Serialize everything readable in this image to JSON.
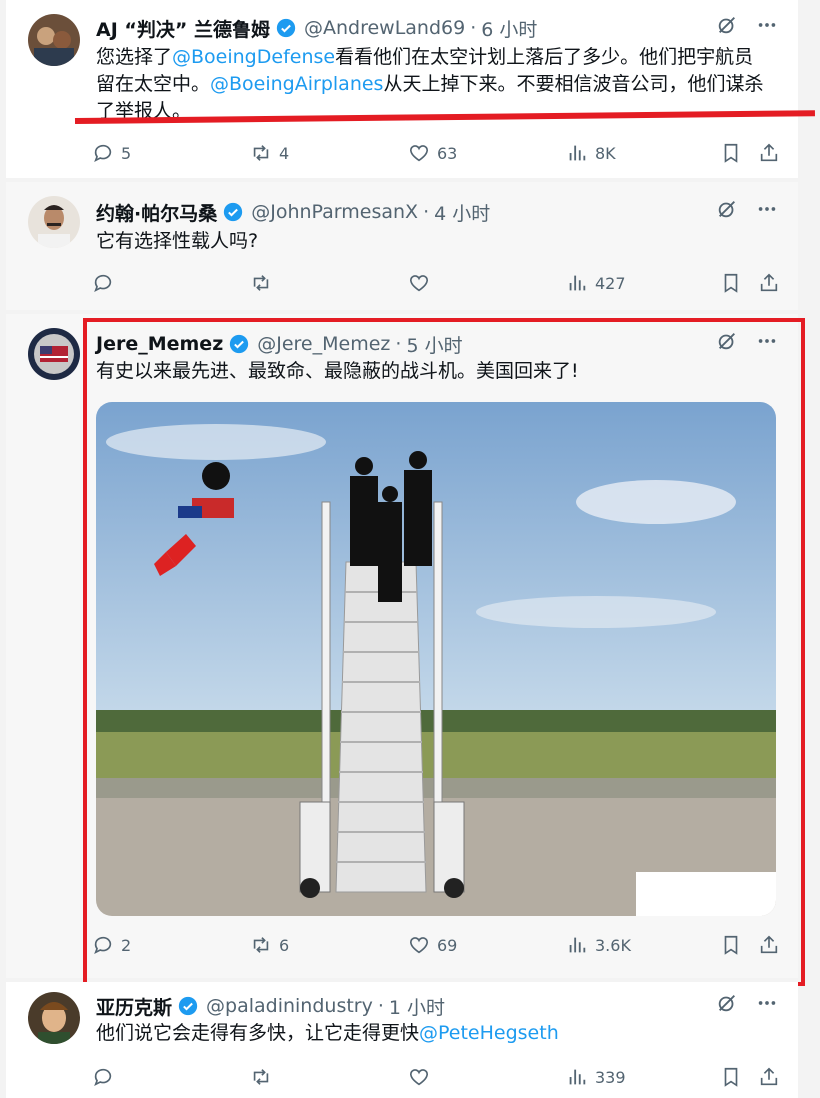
{
  "tweets": [
    {
      "name": "AJ “判决” 兰德鲁姆",
      "handle": "@AndrewLand69",
      "time": "6 小时",
      "text_parts": [
        "您选择了",
        "@BoeingDefense",
        "看看他们在太空计划上落后了多少。他们把宇航员留在太空中。",
        "@BoeingAirplanes",
        "从天上掉下来。不要相信波音公司，他们谋杀了举报人。"
      ],
      "replies": "5",
      "reposts": "4",
      "likes": "63",
      "views": "8K"
    },
    {
      "name": "约翰·帕尔马桑",
      "handle": "@JohnParmesanX",
      "time": "4 小时",
      "text": "它有选择性载人吗?",
      "replies": "",
      "reposts": "",
      "likes": "",
      "views": "427"
    },
    {
      "name": "Jere_Memez",
      "handle": "@Jere_Memez",
      "time": "5 小时",
      "text": "有史以来最先进、最致命、最隐蔽的战斗机。美国回来了!",
      "replies": "2",
      "reposts": "6",
      "likes": "69",
      "views": "3.6K"
    },
    {
      "name": "亚历克斯",
      "handle": "@paladinindustry",
      "time": "1 小时",
      "text_parts": [
        "他们说它会走得有多快，让它走得更快",
        "@PeteHegseth"
      ],
      "replies": "",
      "reposts": "",
      "likes": "",
      "views": "339"
    }
  ],
  "separator": "·",
  "colors": {
    "accent": "#1d9bf0",
    "annotation_red": "#e41c23",
    "muted": "#536471"
  },
  "icons": [
    "verified-badge-icon",
    "grok-icon",
    "more-icon",
    "reply-icon",
    "repost-icon",
    "like-icon",
    "views-icon",
    "bookmark-icon",
    "share-icon"
  ]
}
